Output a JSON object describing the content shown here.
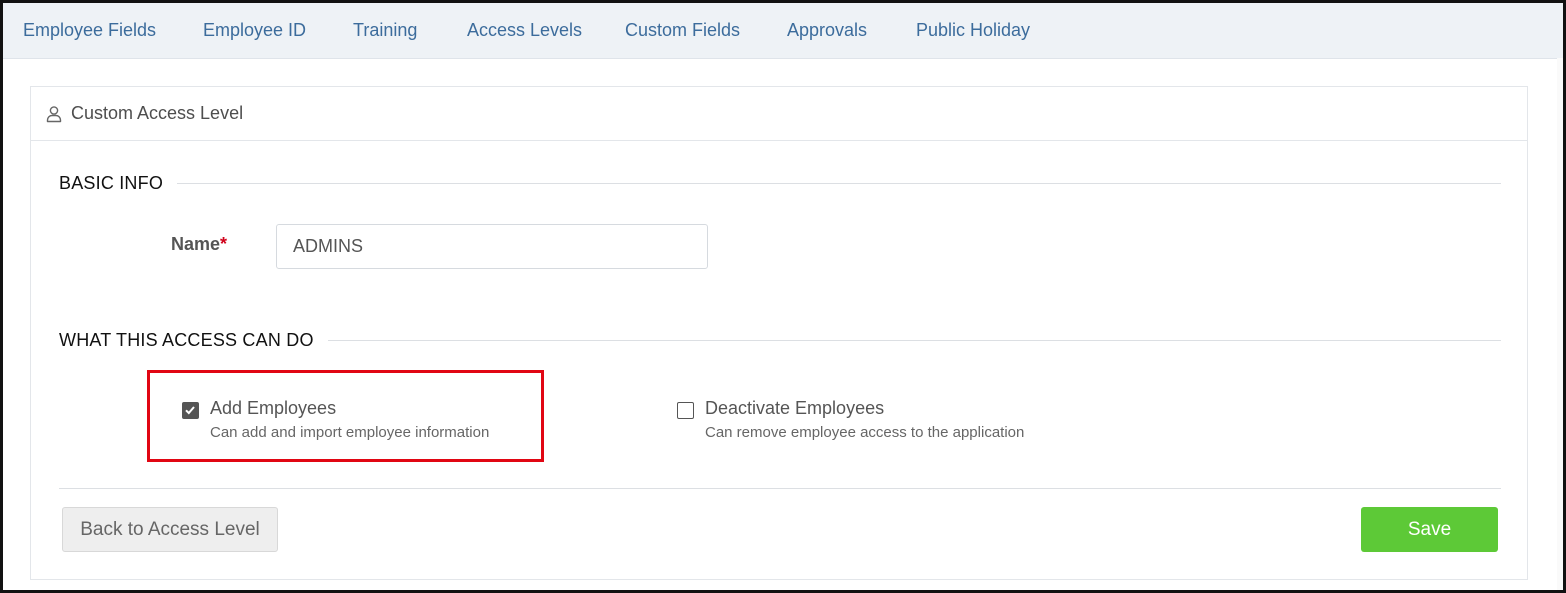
{
  "tabs": [
    {
      "label": "Employee Fields"
    },
    {
      "label": "Employee ID"
    },
    {
      "label": "Training"
    },
    {
      "label": "Access Levels"
    },
    {
      "label": "Custom Fields"
    },
    {
      "label": "Approvals"
    },
    {
      "label": "Public Holiday"
    }
  ],
  "card": {
    "title": "Custom Access Level",
    "icon": "user-icon"
  },
  "basic_info": {
    "section_title": "BASIC INFO",
    "name_label": "Name",
    "required_marker": "*",
    "name_value": "ADMINS"
  },
  "permissions": {
    "section_title": "WHAT THIS ACCESS CAN DO",
    "items": [
      {
        "label": "Add Employees",
        "description": "Can add and import employee information",
        "checked": true
      },
      {
        "label": "Deactivate Employees",
        "description": "Can remove employee access to the application",
        "checked": false
      }
    ]
  },
  "actions": {
    "back_label": "Back to Access Level",
    "save_label": "Save"
  },
  "colors": {
    "tab_text": "#3c6c9c",
    "save_button": "#5dc937",
    "highlight_border": "#e10613",
    "required": "#d0021b"
  }
}
